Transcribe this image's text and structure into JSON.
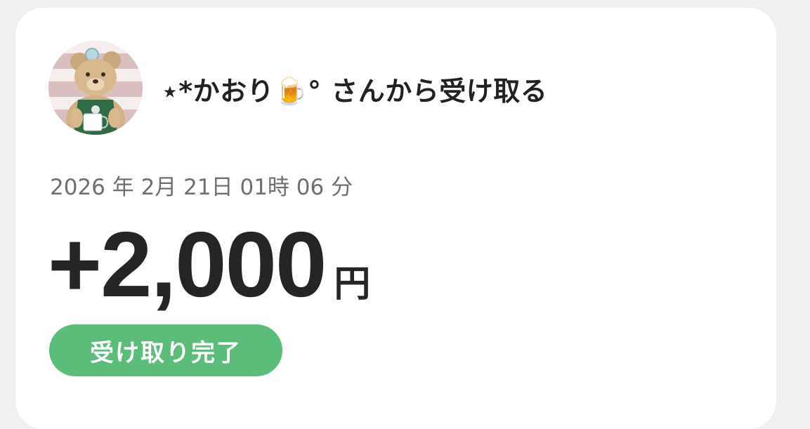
{
  "sender": {
    "nickname": "⋆*かおり🍺°",
    "suffix": " さんから受け取る"
  },
  "timestamp": "2026 年 2月 21日 01時 06 分",
  "amount": {
    "value": "+2,000",
    "currency": "円"
  },
  "status": {
    "label": "受け取り完了",
    "color": "#5cbd7b"
  }
}
